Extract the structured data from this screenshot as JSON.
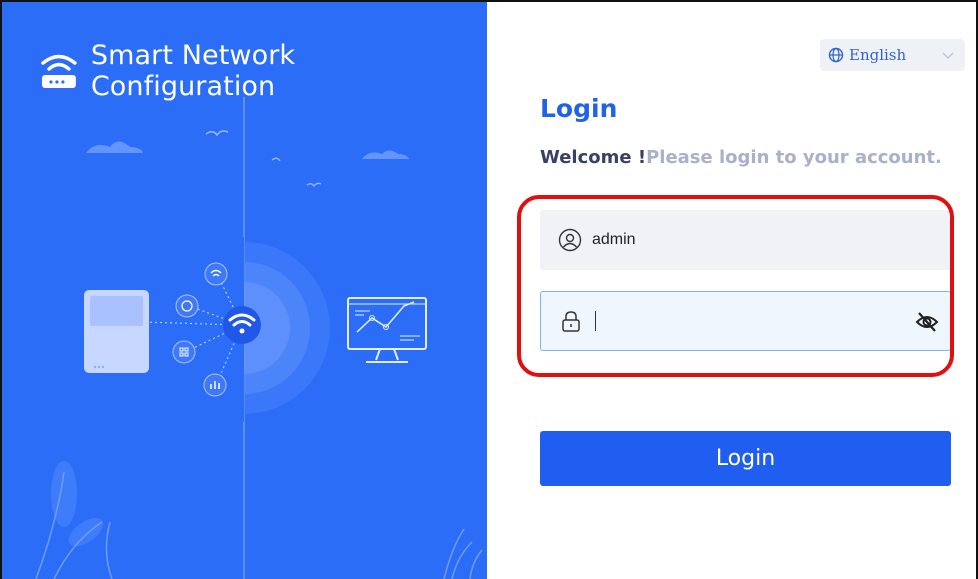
{
  "brand": {
    "title": "Smart Network Configuration",
    "icon": "router-wifi-icon"
  },
  "language": {
    "selected": "English",
    "icon": "globe-icon"
  },
  "login": {
    "title": "Login",
    "welcome_strong": "Welcome !",
    "welcome_light": "Please login to your account.",
    "username_value": "admin",
    "username_icon": "user-icon",
    "password_value": "",
    "password_icon": "lock-icon",
    "password_toggle_icon": "eye-off-icon",
    "button_label": "Login"
  },
  "colors": {
    "hero_blue": "#2b6df7",
    "accent": "#1f5ef0",
    "title": "#2062ea",
    "highlight": "#e01010"
  }
}
